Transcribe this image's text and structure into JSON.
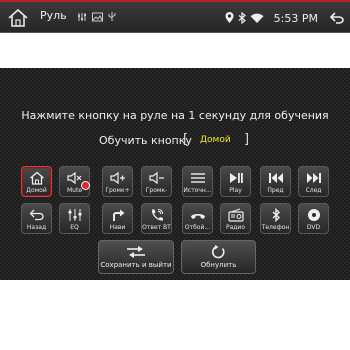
{
  "statusbar": {
    "title": "Руль",
    "time": "5:53 PM",
    "icons": [
      "home-icon",
      "sliders-icon",
      "image-icon",
      "usb-icon",
      "location-icon",
      "bluetooth-icon",
      "wifi-icon",
      "back-icon"
    ]
  },
  "prompt": "Нажмите кнопку на руле на 1 секунду для обучения",
  "learn": {
    "label": "Обучить кнопку",
    "bracket_open": "[",
    "bracket_close": "]",
    "value": "Домой"
  },
  "buttons": [
    {
      "label": "Домой",
      "icon": "home-icon",
      "active": true
    },
    {
      "label": "Mute",
      "icon": "mute-icon",
      "active": false
    },
    {
      "label": "Громк+",
      "icon": "volume-up-icon",
      "active": false
    },
    {
      "label": "Громк-",
      "icon": "volume-down-icon",
      "active": false
    },
    {
      "label": "Источн...",
      "icon": "source-icon",
      "active": false
    },
    {
      "label": "Play",
      "icon": "play-pause-icon",
      "active": false
    },
    {
      "label": "Пред",
      "icon": "previous-icon",
      "active": false
    },
    {
      "label": "След",
      "icon": "next-icon",
      "active": false
    },
    {
      "label": "Назад",
      "icon": "back-icon",
      "active": false
    },
    {
      "label": "EQ",
      "icon": "equalizer-icon",
      "active": false
    },
    {
      "label": "Нави",
      "icon": "navigation-icon",
      "active": false
    },
    {
      "label": "Ответ BT",
      "icon": "phone-answer-icon",
      "active": false
    },
    {
      "label": "Отбой...",
      "icon": "phone-hangup-icon",
      "active": false
    },
    {
      "label": "Радио",
      "icon": "radio-icon",
      "active": false
    },
    {
      "label": "Телефон",
      "icon": "bluetooth-icon",
      "active": false
    },
    {
      "label": "DVD",
      "icon": "disc-icon",
      "active": false
    }
  ],
  "actions": {
    "save_label": "Сохранить и выйти",
    "reset_label": "Обнулить"
  },
  "colors": {
    "accent": "#b8202a",
    "highlight_text": "#f2e628",
    "active_border": "#e23a3a"
  }
}
